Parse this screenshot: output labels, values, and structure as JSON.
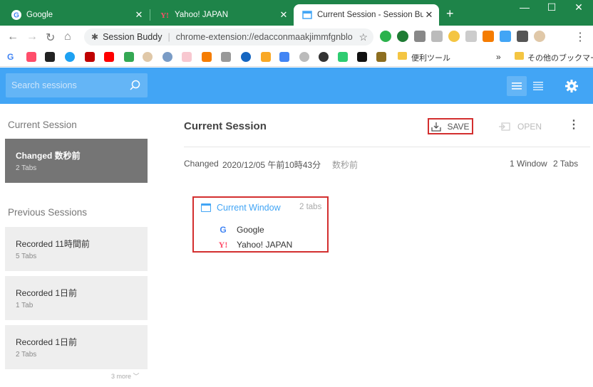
{
  "browser": {
    "tabs": [
      {
        "title": "Google",
        "icon": "google-icon"
      },
      {
        "title": "Yahoo! JAPAN",
        "icon": "yahoo-icon"
      },
      {
        "title": "Current Session - Session Buddy",
        "icon": "session-buddy-icon"
      }
    ],
    "omnibox": {
      "site_name": "Session Buddy",
      "url": "chrome-extension://edacconmaakjimmfgnblo..."
    },
    "bookmarks": {
      "folder_label_1": "便利ツール",
      "folder_label_2": "その他のブックマーク",
      "overflow": "»"
    }
  },
  "app": {
    "search_placeholder": "Search sessions",
    "accent_color": "#42a5f5"
  },
  "sidebar": {
    "current_heading": "Current Session",
    "current_card": {
      "title": "Changed 数秒前",
      "subtitle": "2 Tabs"
    },
    "previous_heading": "Previous Sessions",
    "previous": [
      {
        "title": "Recorded 11時間前",
        "subtitle": "5 Tabs"
      },
      {
        "title": "Recorded 1日前",
        "subtitle": "1 Tab"
      },
      {
        "title": "Recorded 1日前",
        "subtitle": "2 Tabs"
      }
    ],
    "more_label": "3 more"
  },
  "main": {
    "title": "Current Session",
    "save_label": "SAVE",
    "open_label": "OPEN",
    "status": "Changed",
    "timestamp": "2020/12/05 午前10時43分",
    "relative": "数秒前",
    "window_count": "1 Window",
    "tab_count": "2 Tabs",
    "window": {
      "title": "Current Window",
      "count": "2 tabs",
      "tabs": [
        {
          "title": "Google",
          "icon": "google-icon"
        },
        {
          "title": "Yahoo! JAPAN",
          "icon": "yahoo-icon"
        }
      ]
    }
  }
}
